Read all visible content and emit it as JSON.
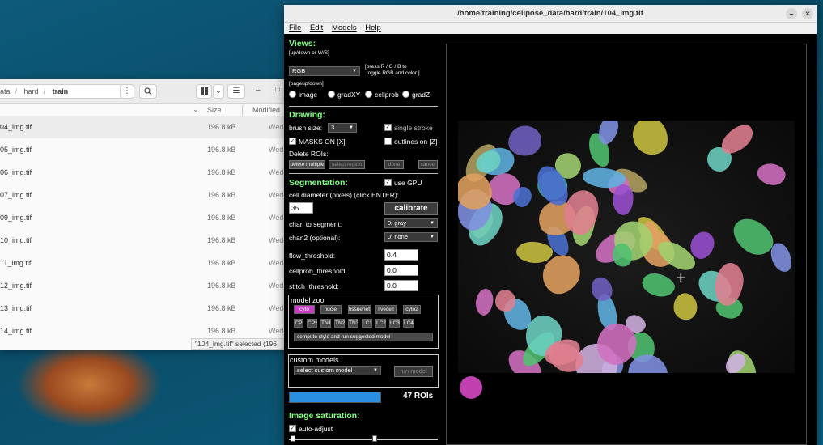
{
  "file_manager": {
    "breadcrumb": [
      "ata",
      "hard",
      "train"
    ],
    "toolbar": {
      "menu_icon": "⋮",
      "search_icon": "search-icon",
      "view_icon": "grid-icon",
      "view_menu": "⌄",
      "list_icon": "☰",
      "minimize": "–",
      "maximize": "□"
    },
    "columns": {
      "sort_arrow": "⌄",
      "size": "Size",
      "modified": "Modified"
    },
    "rows": [
      {
        "name": "04_img.tif",
        "size": "196.8 kB",
        "modified": "Wed",
        "selected": true
      },
      {
        "name": "05_img.tif",
        "size": "196.8 kB",
        "modified": "Wed"
      },
      {
        "name": "06_img.tif",
        "size": "196.8 kB",
        "modified": "Wed"
      },
      {
        "name": "07_img.tif",
        "size": "196.8 kB",
        "modified": "Wed"
      },
      {
        "name": "09_img.tif",
        "size": "196.8 kB",
        "modified": "Wed"
      },
      {
        "name": "10_img.tif",
        "size": "196.8 kB",
        "modified": "Wed"
      },
      {
        "name": "11_img.tif",
        "size": "196.8 kB",
        "modified": "Wed"
      },
      {
        "name": "12_img.tif",
        "size": "196.8 kB",
        "modified": "Wed"
      },
      {
        "name": "13_img.tif",
        "size": "196.8 kB",
        "modified": "Wed"
      },
      {
        "name": "14_img.tif",
        "size": "196.8 kB",
        "modified": "Wed"
      }
    ],
    "status": "\"104_img.tif\" selected  (196"
  },
  "cellpose": {
    "title": "/home/training/cellpose_data/hard/train/104_img.tif",
    "window_buttons": {
      "minimize": "–",
      "close": "✕"
    },
    "menu": [
      "File",
      "Edit",
      "Models",
      "Help"
    ],
    "views": {
      "heading": "Views:",
      "hint": "[up/down or W/S]",
      "color_select": "RGB",
      "color_hint": "[press R / G / B to\n toggle RGB and color ]",
      "page_hint": "[pageup/down]",
      "radios": [
        "image",
        "gradXY",
        "cellprob",
        "gradZ"
      ]
    },
    "drawing": {
      "heading": "Drawing:",
      "brush_label": "brush size:",
      "brush_value": "3",
      "single_stroke": "single stroke",
      "masks_on": "MASKS ON [X]",
      "outlines_on": "outlines on [Z]",
      "delete_rois": "Delete ROIs:",
      "delete_buttons": [
        "delete multiple",
        "select region",
        "done",
        "cancel"
      ]
    },
    "segmentation": {
      "heading": "Segmentation:",
      "use_gpu": "use GPU",
      "diameter_label": "cell diameter (pixels) (click ENTER):",
      "diameter_value": "35",
      "calibrate": "calibrate",
      "chan_label": "chan to segment:",
      "chan_value": "0: gray",
      "chan2_label": "chan2 (optional):",
      "chan2_value": "0: none",
      "flow_label": "flow_threshold:",
      "flow_value": "0.4",
      "cellprob_label": "cellprob_threshold:",
      "cellprob_value": "0.0",
      "stitch_label": "stitch_threshold:",
      "stitch_value": "0.0"
    },
    "model_zoo": {
      "heading": "model zoo",
      "row1": [
        "cyto",
        "nuclei",
        "tissuenet",
        "livecell",
        "cyto2"
      ],
      "row2": [
        "CP",
        "CPx",
        "TN1",
        "TN2",
        "TN3",
        "LC1",
        "LC2",
        "LC3",
        "LC4"
      ],
      "suggest": "compute style and run suggested model"
    },
    "custom_models": {
      "heading": "custom models",
      "select": "select custom model",
      "run": "run model"
    },
    "progress": {
      "label": "",
      "fraction": 1.0,
      "color": "#2a8fe0"
    },
    "roi_count": "47 ROIs",
    "saturation": {
      "heading": "Image saturation:",
      "auto_adjust": "auto-adjust"
    },
    "accent_color": "#80ff80"
  }
}
